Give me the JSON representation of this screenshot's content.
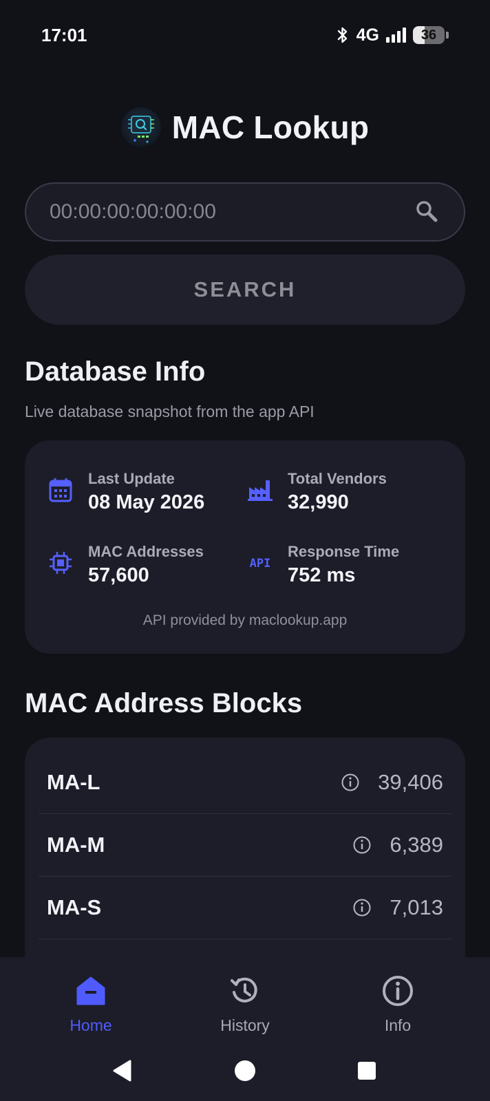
{
  "status_bar": {
    "time": "17:01",
    "network": "4G",
    "battery": "36",
    "battery_percent": 36
  },
  "header": {
    "title": "MAC Lookup",
    "logo_icon": "chip-search-logo-icon"
  },
  "search": {
    "placeholder": "00:00:00:00:00:00",
    "value": "",
    "button_label": "SEARCH"
  },
  "database_info": {
    "title": "Database Info",
    "subtitle": "Live database snapshot from the app API",
    "stats": [
      {
        "label": "Last Update",
        "value": "08 May 2026",
        "icon": "calendar-icon"
      },
      {
        "label": "Total Vendors",
        "value": "32,990",
        "icon": "factory-icon"
      },
      {
        "label": "MAC Addresses",
        "value": "57,600",
        "icon": "chip-icon"
      },
      {
        "label": "Response Time",
        "value": "752 ms",
        "icon": "api-icon"
      }
    ],
    "credit": "API provided by maclookup.app"
  },
  "blocks": {
    "title": "MAC Address Blocks",
    "rows": [
      {
        "name": "MA-L",
        "count": "39,406"
      },
      {
        "name": "MA-M",
        "count": "6,389"
      },
      {
        "name": "MA-S",
        "count": "7,013"
      }
    ]
  },
  "bottom_nav": {
    "items": [
      {
        "label": "Home",
        "icon": "home-icon",
        "active": true
      },
      {
        "label": "History",
        "icon": "history-icon",
        "active": false
      },
      {
        "label": "Info",
        "icon": "info-icon",
        "active": false
      }
    ]
  },
  "colors": {
    "background": "#111118",
    "card": "#1c1d28",
    "accent": "#4f5bff",
    "muted": "#9b9ca6"
  }
}
